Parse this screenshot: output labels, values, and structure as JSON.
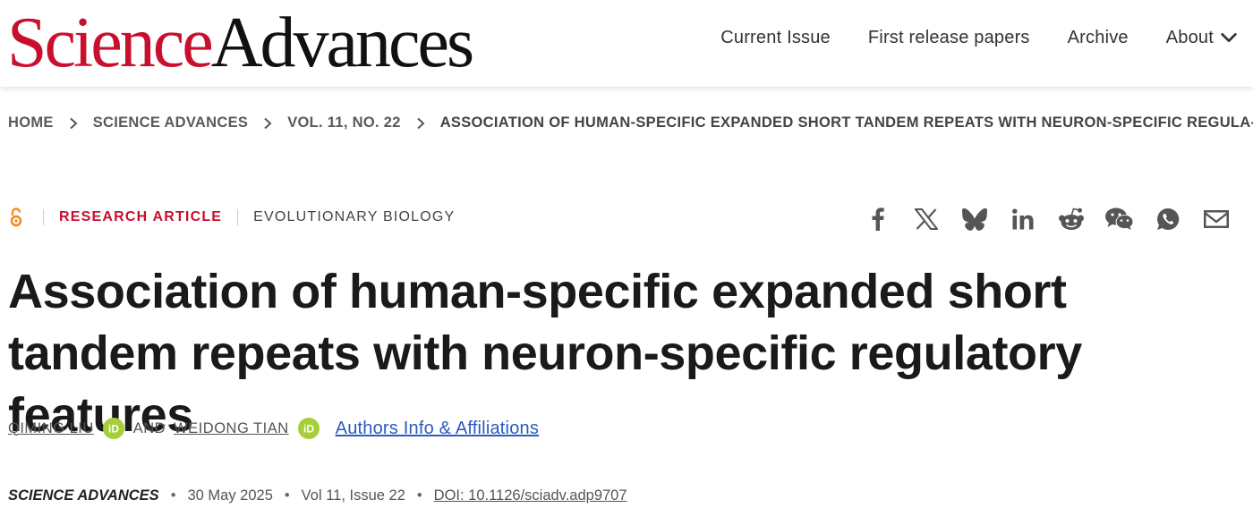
{
  "logo": {
    "part1": "Science",
    "part2": "Advances"
  },
  "nav": {
    "current_issue": "Current Issue",
    "first_release": "First release papers",
    "archive": "Archive",
    "about": "About"
  },
  "breadcrumb": {
    "items": [
      "HOME",
      "SCIENCE ADVANCES",
      "VOL. 11, NO. 22",
      "ASSOCIATION OF HUMAN-SPECIFIC EXPANDED SHORT TANDEM REPEATS WITH NEURON-SPECIFIC REGULA-..."
    ]
  },
  "article": {
    "type": "RESEARCH ARTICLE",
    "subject": "EVOLUTIONARY BIOLOGY",
    "title": "Association of human-specific expanded short tandem repeats with neuron-specific regulatory features",
    "authors": [
      "QIMING LIU",
      "WEIDONG TIAN"
    ],
    "and": "AND",
    "affiliations_link": "Authors Info & Affiliations",
    "journal": "SCIENCE ADVANCES",
    "date": "30 May 2025",
    "volume_issue": "Vol 11, Issue 22",
    "doi": "DOI: 10.1126/sciadv.adp9707"
  },
  "share_icons": [
    "facebook-icon",
    "x-icon",
    "bluesky-icon",
    "linkedin-icon",
    "reddit-icon",
    "wechat-icon",
    "whatsapp-icon",
    "email-icon"
  ],
  "colors": {
    "brand_red": "#c8102e",
    "link_blue": "#2a5bbf",
    "orcid_green": "#a6ce39",
    "open_access_orange": "#f68212"
  }
}
